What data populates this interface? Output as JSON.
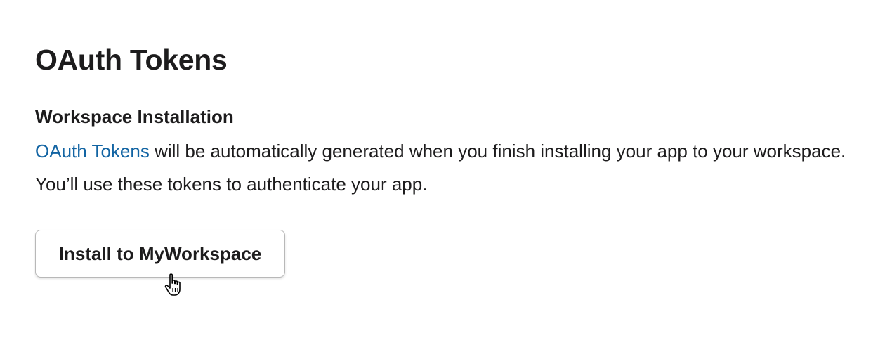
{
  "section": {
    "title": "OAuth Tokens",
    "subheading": "Workspace Installation",
    "description": {
      "link_text": "OAuth Tokens",
      "text": " will be automatically generated when you finish installing your app to your workspace. You’ll use these tokens to authenticate your app."
    },
    "install_button_label": "Install to MyWorkspace"
  },
  "colors": {
    "text": "#1d1c1d",
    "link": "#1264a3",
    "button_border": "#b8b8b8",
    "background": "#ffffff"
  },
  "icons": {
    "cursor": "hand-pointer-icon"
  }
}
